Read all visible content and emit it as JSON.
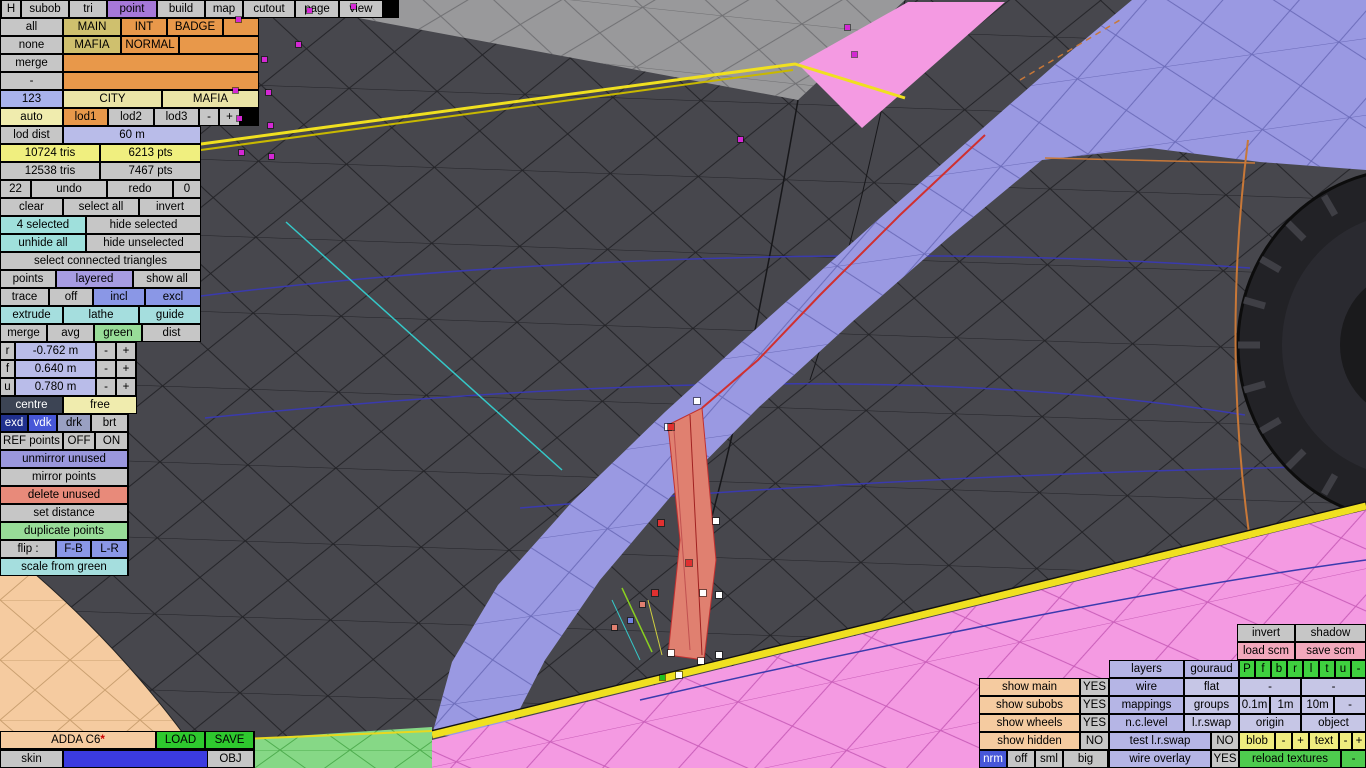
{
  "menu": {
    "items": [
      "H",
      "subob",
      "tri",
      "point",
      "build",
      "map",
      "cutout",
      "page",
      "view"
    ],
    "active_item": "point"
  },
  "left_panel": {
    "select_col": [
      "all",
      "none",
      "merge",
      "-"
    ],
    "number_badge": "123",
    "auto_label": "auto",
    "material_grid": {
      "row1": [
        "MAIN",
        "INT",
        "BADGE"
      ],
      "row2": [
        "MAFIA",
        "NORMAL"
      ]
    },
    "variant_row": [
      "CITY",
      "MAFIA"
    ],
    "lod_tabs": [
      "lod1",
      "lod2",
      "lod3"
    ],
    "lod_minus": "-",
    "lod_plus": "+",
    "lod_dist": {
      "label": "lod dist",
      "value": "60 m"
    },
    "stats_selected": {
      "tris": "10724 tris",
      "pts": "6213 pts"
    },
    "stats_total": {
      "tris": "12538 tris",
      "pts": "7467 pts"
    },
    "history": {
      "undo_count": "22",
      "undo": "undo",
      "redo": "redo",
      "redo_count": "0"
    },
    "selection_ops": [
      "clear",
      "select all",
      "invert"
    ],
    "selected_row": {
      "count": "4 selected",
      "hide": "hide selected"
    },
    "unhide_row": {
      "unhide": "unhide all",
      "hide_unsel": "hide unselected"
    },
    "select_connected": "select connected triangles",
    "points_row": [
      "points",
      "layered",
      "show all"
    ],
    "trace_row": [
      "trace",
      "off",
      "incl",
      "excl"
    ],
    "tools_row": [
      "extrude",
      "lathe",
      "guide"
    ],
    "merge_row": [
      "merge",
      "avg",
      "green",
      "dist"
    ],
    "coords": [
      {
        "axis": "r",
        "value": "-0.762 m"
      },
      {
        "axis": "f",
        "value": "0.640 m"
      },
      {
        "axis": "u",
        "value": "0.780 m"
      }
    ],
    "coord_minus": "-",
    "coord_plus": "+",
    "pivot_row": [
      "centre",
      "free"
    ],
    "shade_row": [
      "exd",
      "vdk",
      "drk",
      "brt"
    ],
    "ref_row": [
      "REF points",
      "OFF",
      "ON"
    ],
    "actions": [
      "unmirror unused",
      "mirror points",
      "delete unused",
      "set distance",
      "duplicate points"
    ],
    "flip_row": [
      "flip :",
      "F-B",
      "L-R"
    ],
    "scale_from_green": "scale from green"
  },
  "bottom_left": {
    "model_name": "ADDA C6",
    "model_star": "*",
    "load": "LOAD",
    "save": "SAVE",
    "skin": "skin",
    "obj": "OBJ"
  },
  "bottom_right": {
    "invert": "invert",
    "shadow": "shadow",
    "load_scm": "load scm",
    "save_scm": "save scm",
    "layers": "layers",
    "gouraud": "gouraud",
    "letter_cells": [
      "P",
      "f",
      "b",
      "r",
      "l",
      "t",
      "u",
      "-"
    ],
    "rows": [
      {
        "label": "show main",
        "state": "YES"
      },
      {
        "label": "show subobs",
        "state": "YES"
      },
      {
        "label": "show wheels",
        "state": "YES"
      },
      {
        "label": "show hidden",
        "state": "NO"
      }
    ],
    "wire": "wire",
    "flat": "flat",
    "mappings": "mappings",
    "groups": "groups",
    "ncl": "n.c.level",
    "lrswap": "l.r.swap",
    "test_lrswap": "test l.r.swap",
    "test_lrswap_state": "NO",
    "grid_cells": [
      "0.1m",
      "1m",
      "10m",
      "-"
    ],
    "dash1": "-",
    "dash2": "-",
    "origin": "origin",
    "object": "object",
    "blob": "blob",
    "blob_minus": "-",
    "blob_plus": "+",
    "text_label": "text",
    "text_minus": "-",
    "text_plus": "+",
    "nrm_row": [
      "nrm",
      "off",
      "sml",
      "big"
    ],
    "wire_overlay": "wire overlay",
    "wire_overlay_state": "YES",
    "reload_textures": "reload textures",
    "reload_dash": "-"
  },
  "canvas": {
    "background": "#47474d",
    "colors": {
      "band": "#9a99e2",
      "pink": "#f49ae2",
      "yellow": "#f0e020",
      "selection": "#e08070",
      "roof_gray": "#99999b",
      "tire": "#222226",
      "peach": "#f5cba0",
      "green": "#86d886",
      "wire_blue": "#3a3aae",
      "cyan_guide": "#35c8c8",
      "arch_orange": "#c87838",
      "vertex_magenta": "#d428d4"
    },
    "points": {
      "magenta": [
        [
          236,
          17
        ],
        [
          233,
          88
        ],
        [
          237,
          116
        ],
        [
          239,
          150
        ],
        [
          266,
          90
        ],
        [
          268,
          123
        ],
        [
          269,
          154
        ],
        [
          262,
          57
        ],
        [
          296,
          42
        ],
        [
          307,
          8
        ],
        [
          351,
          4
        ],
        [
          845,
          25
        ],
        [
          852,
          52
        ],
        [
          738,
          137
        ]
      ],
      "white": [
        [
          694,
          398
        ],
        [
          665,
          424
        ],
        [
          713,
          518
        ],
        [
          700,
          590
        ],
        [
          716,
          592
        ],
        [
          668,
          650
        ],
        [
          698,
          658
        ],
        [
          716,
          652
        ],
        [
          676,
          672
        ]
      ],
      "red": [
        [
          668,
          424
        ],
        [
          658,
          520
        ],
        [
          652,
          590
        ],
        [
          686,
          560
        ]
      ],
      "misc": [
        [
          628,
          618,
          "#7080e0"
        ],
        [
          640,
          602,
          "#e08070"
        ],
        [
          612,
          625,
          "#e08070"
        ],
        [
          660,
          675,
          "#20c020"
        ]
      ]
    }
  }
}
